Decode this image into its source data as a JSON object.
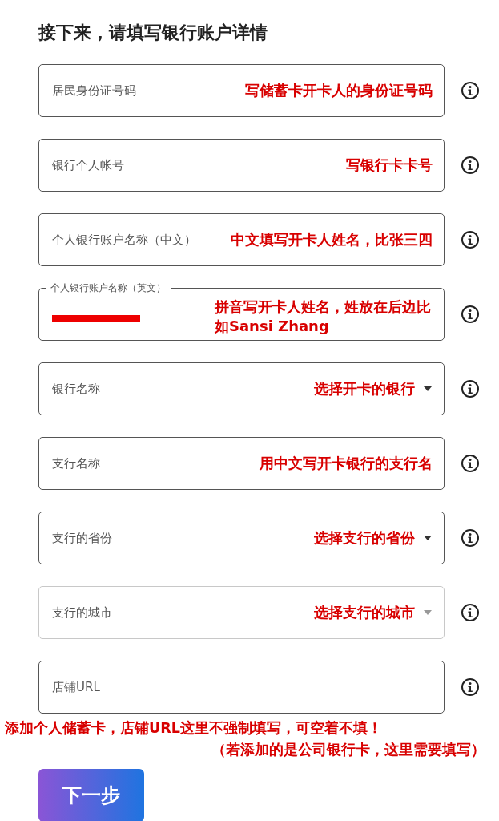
{
  "title": "接下来，请填写银行账户详情",
  "fields": [
    {
      "kind": "text",
      "label": "居民身份证号码",
      "note": "写储蓄卡开卡人的身份证号码",
      "disabled": false
    },
    {
      "kind": "text",
      "label": "银行个人帐号",
      "note": "写银行卡卡号",
      "disabled": false
    },
    {
      "kind": "text",
      "label": "个人银行账户名称（中文）",
      "note": "中文填写开卡人姓名，比张三四",
      "disabled": false
    },
    {
      "kind": "redacted",
      "label": "个人银行账户名称（英文）",
      "note": "拼音写开卡人姓名，姓放在后边比如Sansi Zhang",
      "disabled": false
    },
    {
      "kind": "select",
      "label": "银行名称",
      "note": "选择开卡的银行",
      "disabled": false
    },
    {
      "kind": "text",
      "label": "支行名称",
      "note": "用中文写开卡银行的支行名",
      "disabled": false
    },
    {
      "kind": "select",
      "label": "支行的省份",
      "note": "选择支行的省份",
      "disabled": false
    },
    {
      "kind": "select",
      "label": "支行的城市",
      "note": "选择支行的城市",
      "disabled": true
    },
    {
      "kind": "text",
      "label": "店铺URL",
      "disabled": false
    }
  ],
  "footnote_lines": [
    "添加个人储蓄卡，店铺URL这里不强制填写，可空着不填！",
    "（若添加的是公司银行卡，这里需要填写）"
  ],
  "next_button": "下一步"
}
